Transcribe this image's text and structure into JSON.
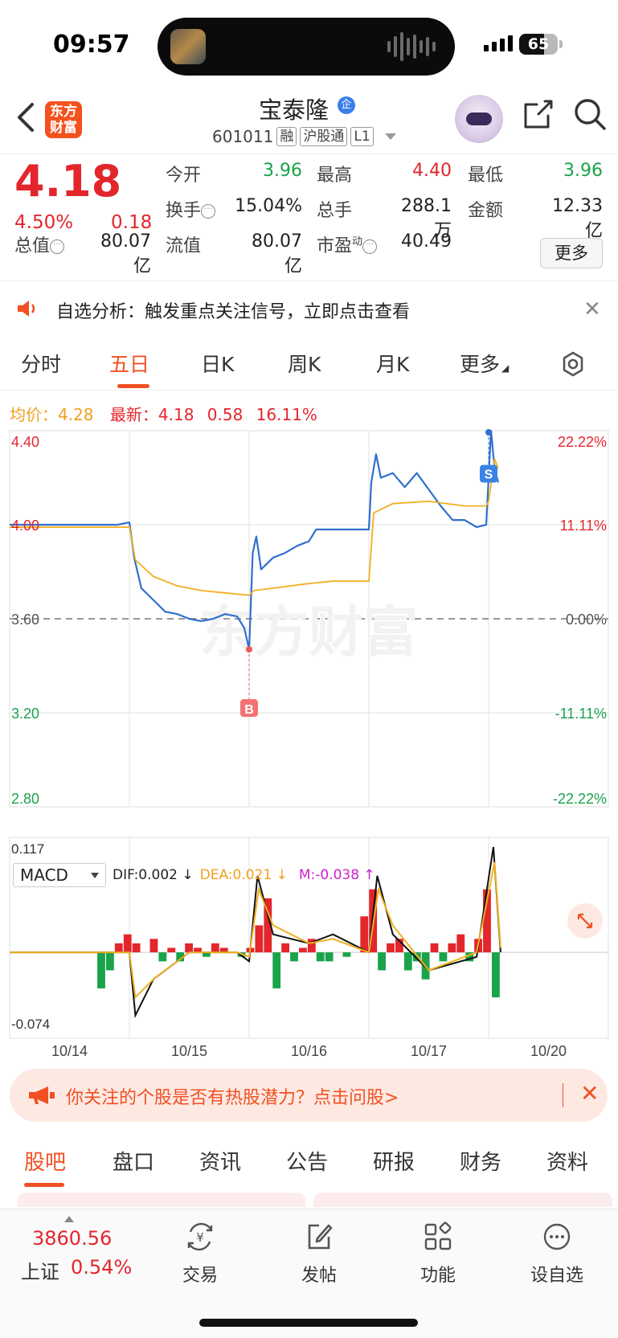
{
  "status_bar": {
    "time": "09:57",
    "battery": "65",
    "battery_level": 0.65
  },
  "header": {
    "logo_line1": "东方",
    "logo_line2": "财富",
    "stock_name": "宝泰隆",
    "name_badge": "企",
    "code": "601011",
    "tags": [
      "融",
      "沪股通",
      "L1"
    ]
  },
  "quote": {
    "price": "4.18",
    "change_pct": "4.50%",
    "change": "0.18",
    "fields": [
      {
        "label": "今开",
        "value": "3.96",
        "color": "green"
      },
      {
        "label": "最高",
        "value": "4.40",
        "color": "red"
      },
      {
        "label": "最低",
        "value": "3.96",
        "color": "green"
      },
      {
        "label": "换手",
        "value": "15.04%",
        "color": "normal"
      },
      {
        "label": "总手",
        "value": "288.1万",
        "color": "normal"
      },
      {
        "label": "金额",
        "value": "12.33亿",
        "color": "normal"
      },
      {
        "label": "总值",
        "value": "80.07亿",
        "color": "normal"
      },
      {
        "label": "流值",
        "value": "80.07亿",
        "color": "normal"
      },
      {
        "label": "市盈",
        "label_sup": "动",
        "value": "40.49",
        "color": "normal"
      }
    ],
    "more_button": "更多"
  },
  "notice": {
    "text": "自选分析：触发重点关注信号，立即点击查看"
  },
  "tabs": [
    {
      "label": "分时",
      "active": false
    },
    {
      "label": "五日",
      "active": true
    },
    {
      "label": "日K",
      "active": false
    },
    {
      "label": "周K",
      "active": false
    },
    {
      "label": "月K",
      "active": false
    },
    {
      "label": "更多",
      "active": false
    }
  ],
  "chart_header": {
    "avg_label": "均价：",
    "avg_value": "4.28",
    "latest_label": "最新：",
    "latest_price": "4.18",
    "latest_change": "0.58",
    "latest_pct": "16.11%"
  },
  "chart_data": [
    {
      "type": "line",
      "x": [
        "10/14",
        "10/15",
        "10/16",
        "10/17",
        "10/20"
      ],
      "ylim": [
        2.8,
        4.4
      ],
      "y_ticks_left": [
        "4.40",
        "4.00",
        "3.60",
        "3.20",
        "2.80"
      ],
      "y_ticks_right": [
        "22.22%",
        "11.11%",
        "0.00%",
        "-11.11%",
        "-22.22%"
      ],
      "reference_price": 3.6,
      "series": [
        {
          "name": "价格",
          "color": "#2f6fce",
          "points": [
            [
              0.0,
              4.0
            ],
            [
              0.3,
              4.0
            ],
            [
              0.6,
              4.0
            ],
            [
              0.9,
              4.0
            ],
            [
              1.0,
              4.01
            ],
            [
              1.04,
              3.86
            ],
            [
              1.1,
              3.73
            ],
            [
              1.2,
              3.68
            ],
            [
              1.3,
              3.63
            ],
            [
              1.4,
              3.62
            ],
            [
              1.5,
              3.6
            ],
            [
              1.6,
              3.59
            ],
            [
              1.7,
              3.6
            ],
            [
              1.8,
              3.62
            ],
            [
              1.9,
              3.61
            ],
            [
              1.96,
              3.56
            ],
            [
              2.0,
              3.47
            ],
            [
              2.03,
              3.88
            ],
            [
              2.06,
              3.95
            ],
            [
              2.1,
              3.81
            ],
            [
              2.2,
              3.86
            ],
            [
              2.3,
              3.88
            ],
            [
              2.4,
              3.91
            ],
            [
              2.5,
              3.93
            ],
            [
              2.56,
              3.98
            ],
            [
              2.65,
              3.98
            ],
            [
              2.8,
              3.98
            ],
            [
              3.0,
              3.98
            ],
            [
              3.02,
              4.18
            ],
            [
              3.06,
              4.3
            ],
            [
              3.1,
              4.2
            ],
            [
              3.2,
              4.22
            ],
            [
              3.3,
              4.16
            ],
            [
              3.4,
              4.22
            ],
            [
              3.5,
              4.15
            ],
            [
              3.6,
              4.08
            ],
            [
              3.7,
              4.02
            ],
            [
              3.8,
              4.02
            ],
            [
              3.9,
              3.99
            ],
            [
              3.98,
              4.0
            ],
            [
              4.0,
              4.2
            ],
            [
              4.02,
              4.4
            ],
            [
              4.05,
              4.24
            ],
            [
              4.08,
              4.18
            ]
          ]
        },
        {
          "name": "均价",
          "color": "#f0b020",
          "points": [
            [
              0.0,
              3.99
            ],
            [
              0.9,
              3.99
            ],
            [
              1.0,
              3.99
            ],
            [
              1.05,
              3.85
            ],
            [
              1.2,
              3.78
            ],
            [
              1.4,
              3.74
            ],
            [
              1.6,
              3.72
            ],
            [
              1.8,
              3.71
            ],
            [
              2.0,
              3.7
            ],
            [
              2.04,
              3.72
            ],
            [
              2.2,
              3.73
            ],
            [
              2.5,
              3.75
            ],
            [
              2.7,
              3.76
            ],
            [
              3.0,
              3.76
            ],
            [
              3.04,
              4.05
            ],
            [
              3.2,
              4.09
            ],
            [
              3.5,
              4.1
            ],
            [
              3.8,
              4.08
            ],
            [
              3.98,
              4.08
            ],
            [
              4.0,
              4.1
            ],
            [
              4.05,
              4.28
            ],
            [
              4.08,
              4.24
            ]
          ]
        }
      ],
      "markers": [
        {
          "label": "B",
          "x": 2.0,
          "y": 3.47
        },
        {
          "label": "S",
          "x": 4.0,
          "y": 4.2
        }
      ]
    },
    {
      "type": "bar",
      "title": "MACD",
      "ylim": [
        -0.074,
        0.117
      ],
      "y_ticks": [
        "0.117",
        "-0.074"
      ],
      "x": [
        "10/14",
        "10/15",
        "10/16",
        "10/17",
        "10/20"
      ],
      "series": [
        {
          "name": "DIF",
          "value": 0.002,
          "color": "#111111",
          "points": [
            [
              0,
              0
            ],
            [
              1.0,
              0
            ],
            [
              1.05,
              -0.07
            ],
            [
              1.2,
              -0.03
            ],
            [
              1.5,
              0
            ],
            [
              1.9,
              0
            ],
            [
              2.0,
              -0.01
            ],
            [
              2.07,
              0.085
            ],
            [
              2.2,
              0.02
            ],
            [
              2.5,
              0.01
            ],
            [
              2.7,
              0.02
            ],
            [
              3.0,
              0
            ],
            [
              3.07,
              0.085
            ],
            [
              3.2,
              0.02
            ],
            [
              3.5,
              -0.02
            ],
            [
              3.9,
              -0.005
            ],
            [
              4.04,
              0.117
            ],
            [
              4.1,
              0
            ]
          ]
        },
        {
          "name": "DEA",
          "value": 0.021,
          "color": "#f0b020",
          "points": [
            [
              0,
              0
            ],
            [
              1.0,
              0
            ],
            [
              1.05,
              -0.05
            ],
            [
              1.2,
              -0.03
            ],
            [
              1.5,
              0
            ],
            [
              1.9,
              0
            ],
            [
              2.0,
              -0.005
            ],
            [
              2.08,
              0.07
            ],
            [
              2.2,
              0.03
            ],
            [
              2.5,
              0.01
            ],
            [
              2.7,
              0.015
            ],
            [
              3.0,
              0
            ],
            [
              3.08,
              0.07
            ],
            [
              3.2,
              0.03
            ],
            [
              3.5,
              -0.02
            ],
            [
              3.9,
              0
            ],
            [
              4.05,
              0.1
            ],
            [
              4.1,
              0.005
            ]
          ]
        },
        {
          "name": "M",
          "value": -0.038,
          "color": "#cc22cc"
        }
      ],
      "histogram": [
        0,
        0,
        0,
        0,
        0,
        0,
        0,
        0,
        0,
        0,
        -0.04,
        -0.02,
        0.01,
        0.02,
        0.01,
        0,
        0.015,
        -0.01,
        0.005,
        -0.01,
        0.01,
        0.005,
        -0.005,
        0.01,
        0.005,
        0,
        -0.005,
        0.005,
        0.03,
        0.06,
        -0.04,
        0.01,
        -0.01,
        0.005,
        0.015,
        -0.01,
        -0.01,
        0,
        -0.005,
        0,
        0.04,
        0.07,
        -0.02,
        0.01,
        0.015,
        -0.02,
        -0.01,
        -0.03,
        0.01,
        -0.01,
        0.01,
        0.02,
        -0.01,
        0.015,
        0.07,
        -0.05
      ]
    }
  ],
  "macd": {
    "selector": "MACD",
    "dif": "DIF:0.002 ↓",
    "dea": "DEA:0.021 ↓",
    "m": "M:-0.038 ↑"
  },
  "banner": {
    "text": "你关注的个股是否有热股潜力？点击问股>"
  },
  "subtabs": [
    "股吧",
    "盘口",
    "资讯",
    "公告",
    "研报",
    "财务",
    "资料"
  ],
  "bottom_nav": {
    "index_value": "3860.56",
    "index_name": "上证",
    "index_pct": "0.54%",
    "items": [
      {
        "label": "交易",
        "icon": "yen-exchange-icon"
      },
      {
        "label": "发帖",
        "icon": "edit-icon"
      },
      {
        "label": "功能",
        "icon": "grid-icon"
      },
      {
        "label": "设自选",
        "icon": "more-dots-icon"
      }
    ]
  },
  "colors": {
    "up": "#e3262c",
    "down": "#1aa34a",
    "accent": "#f05023",
    "price_line": "#2f6fce",
    "avg_line": "#f0b020"
  }
}
